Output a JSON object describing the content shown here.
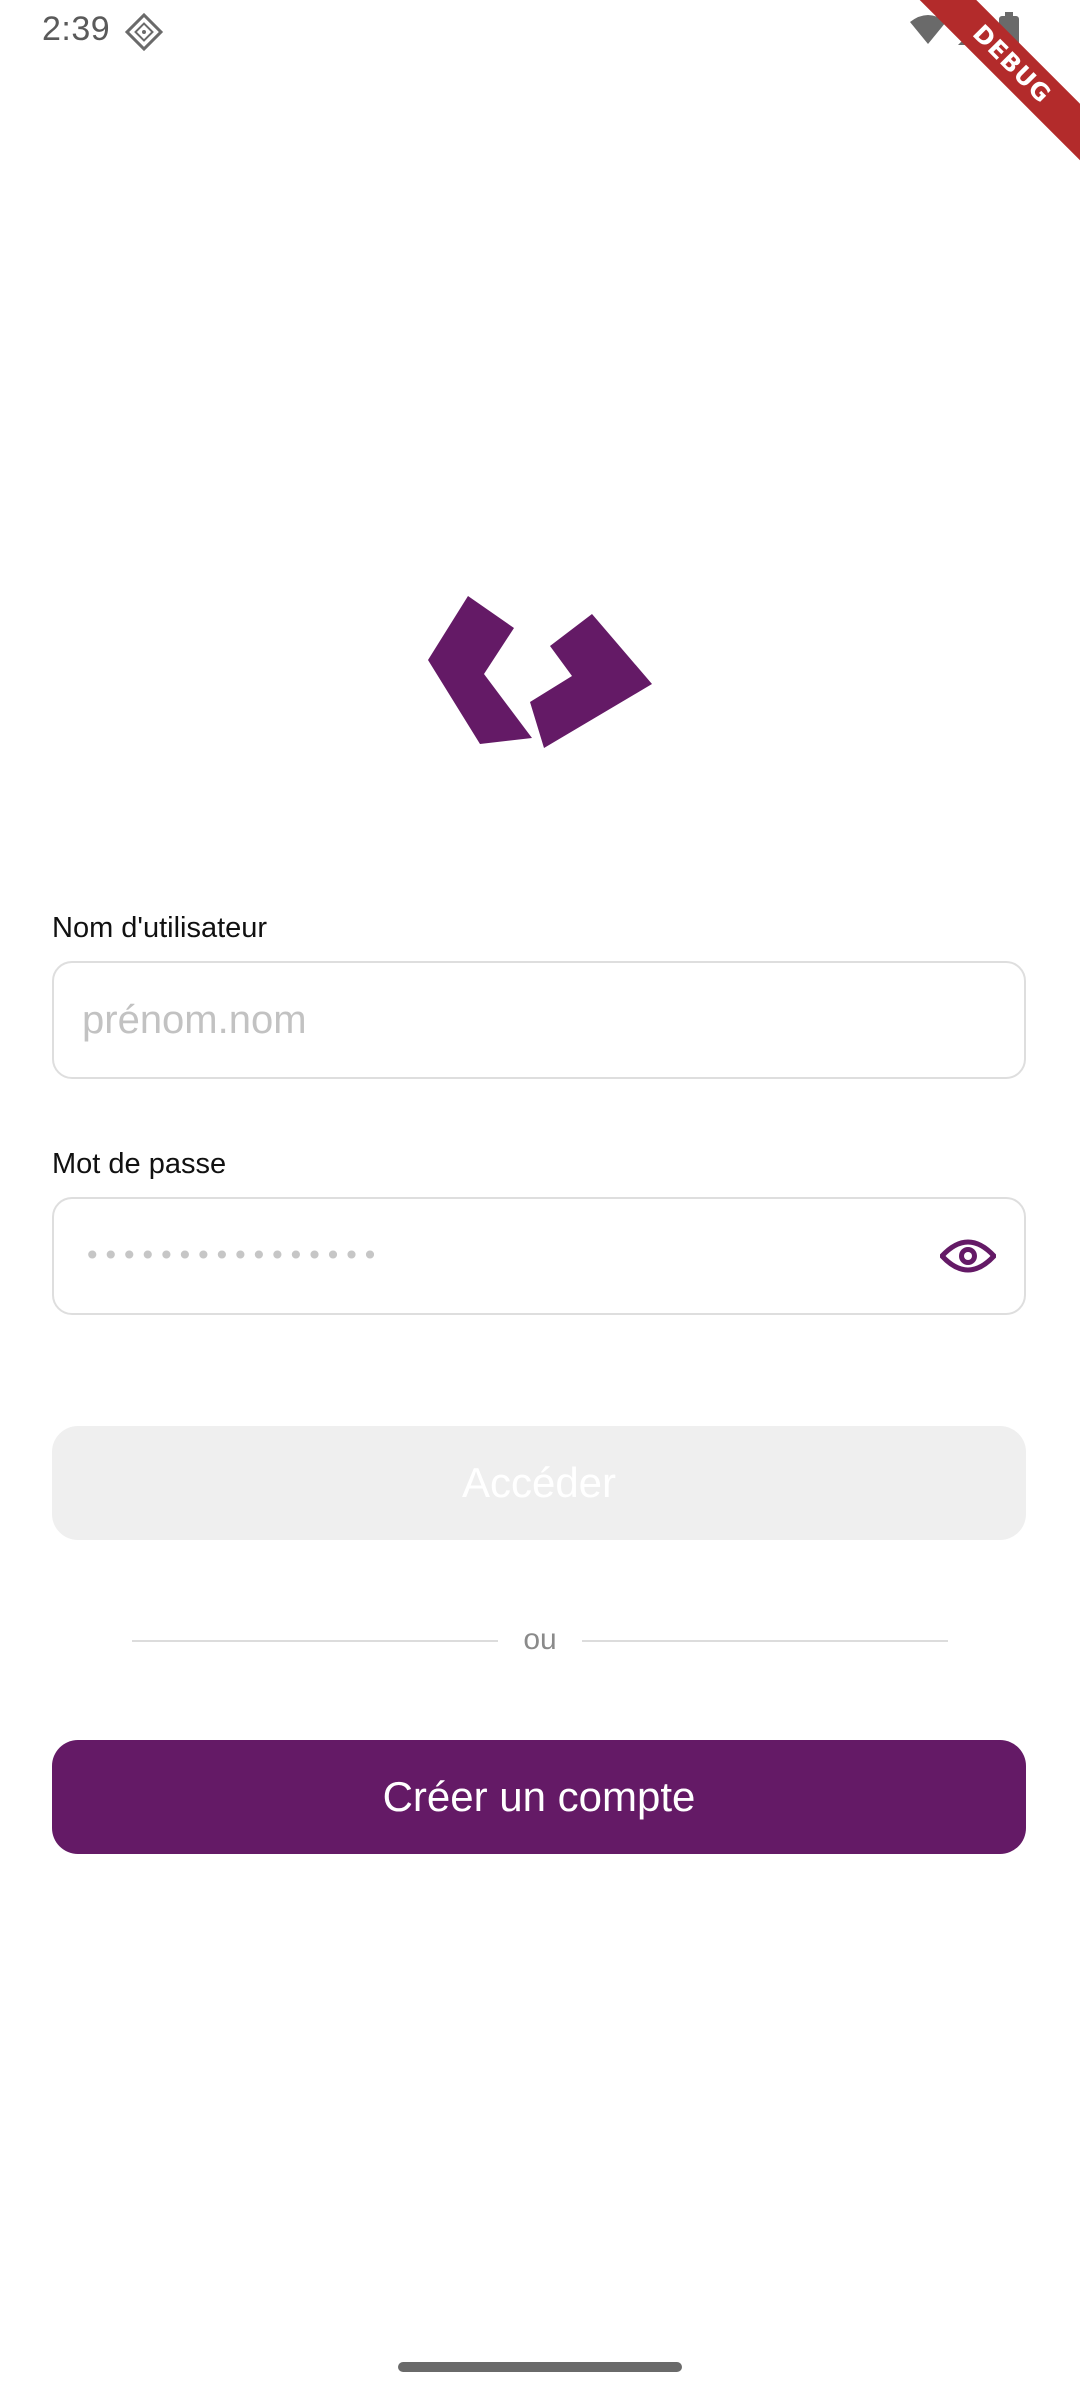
{
  "status_bar": {
    "time": "2:39"
  },
  "debug_banner": {
    "label": "DEBUG"
  },
  "form": {
    "username": {
      "label": "Nom d'utilisateur",
      "placeholder": "prénom.nom",
      "value": ""
    },
    "password": {
      "label": "Mot de passe",
      "masked_value": "••••••••••••••••",
      "toggle_icon": "eye-icon"
    }
  },
  "buttons": {
    "access_label": "Accéder",
    "divider_label": "ou",
    "create_account_label": "Créer un compte"
  },
  "colors": {
    "brand": "#641a66",
    "disabled_button": "#efefef",
    "field_border": "#dedede"
  }
}
